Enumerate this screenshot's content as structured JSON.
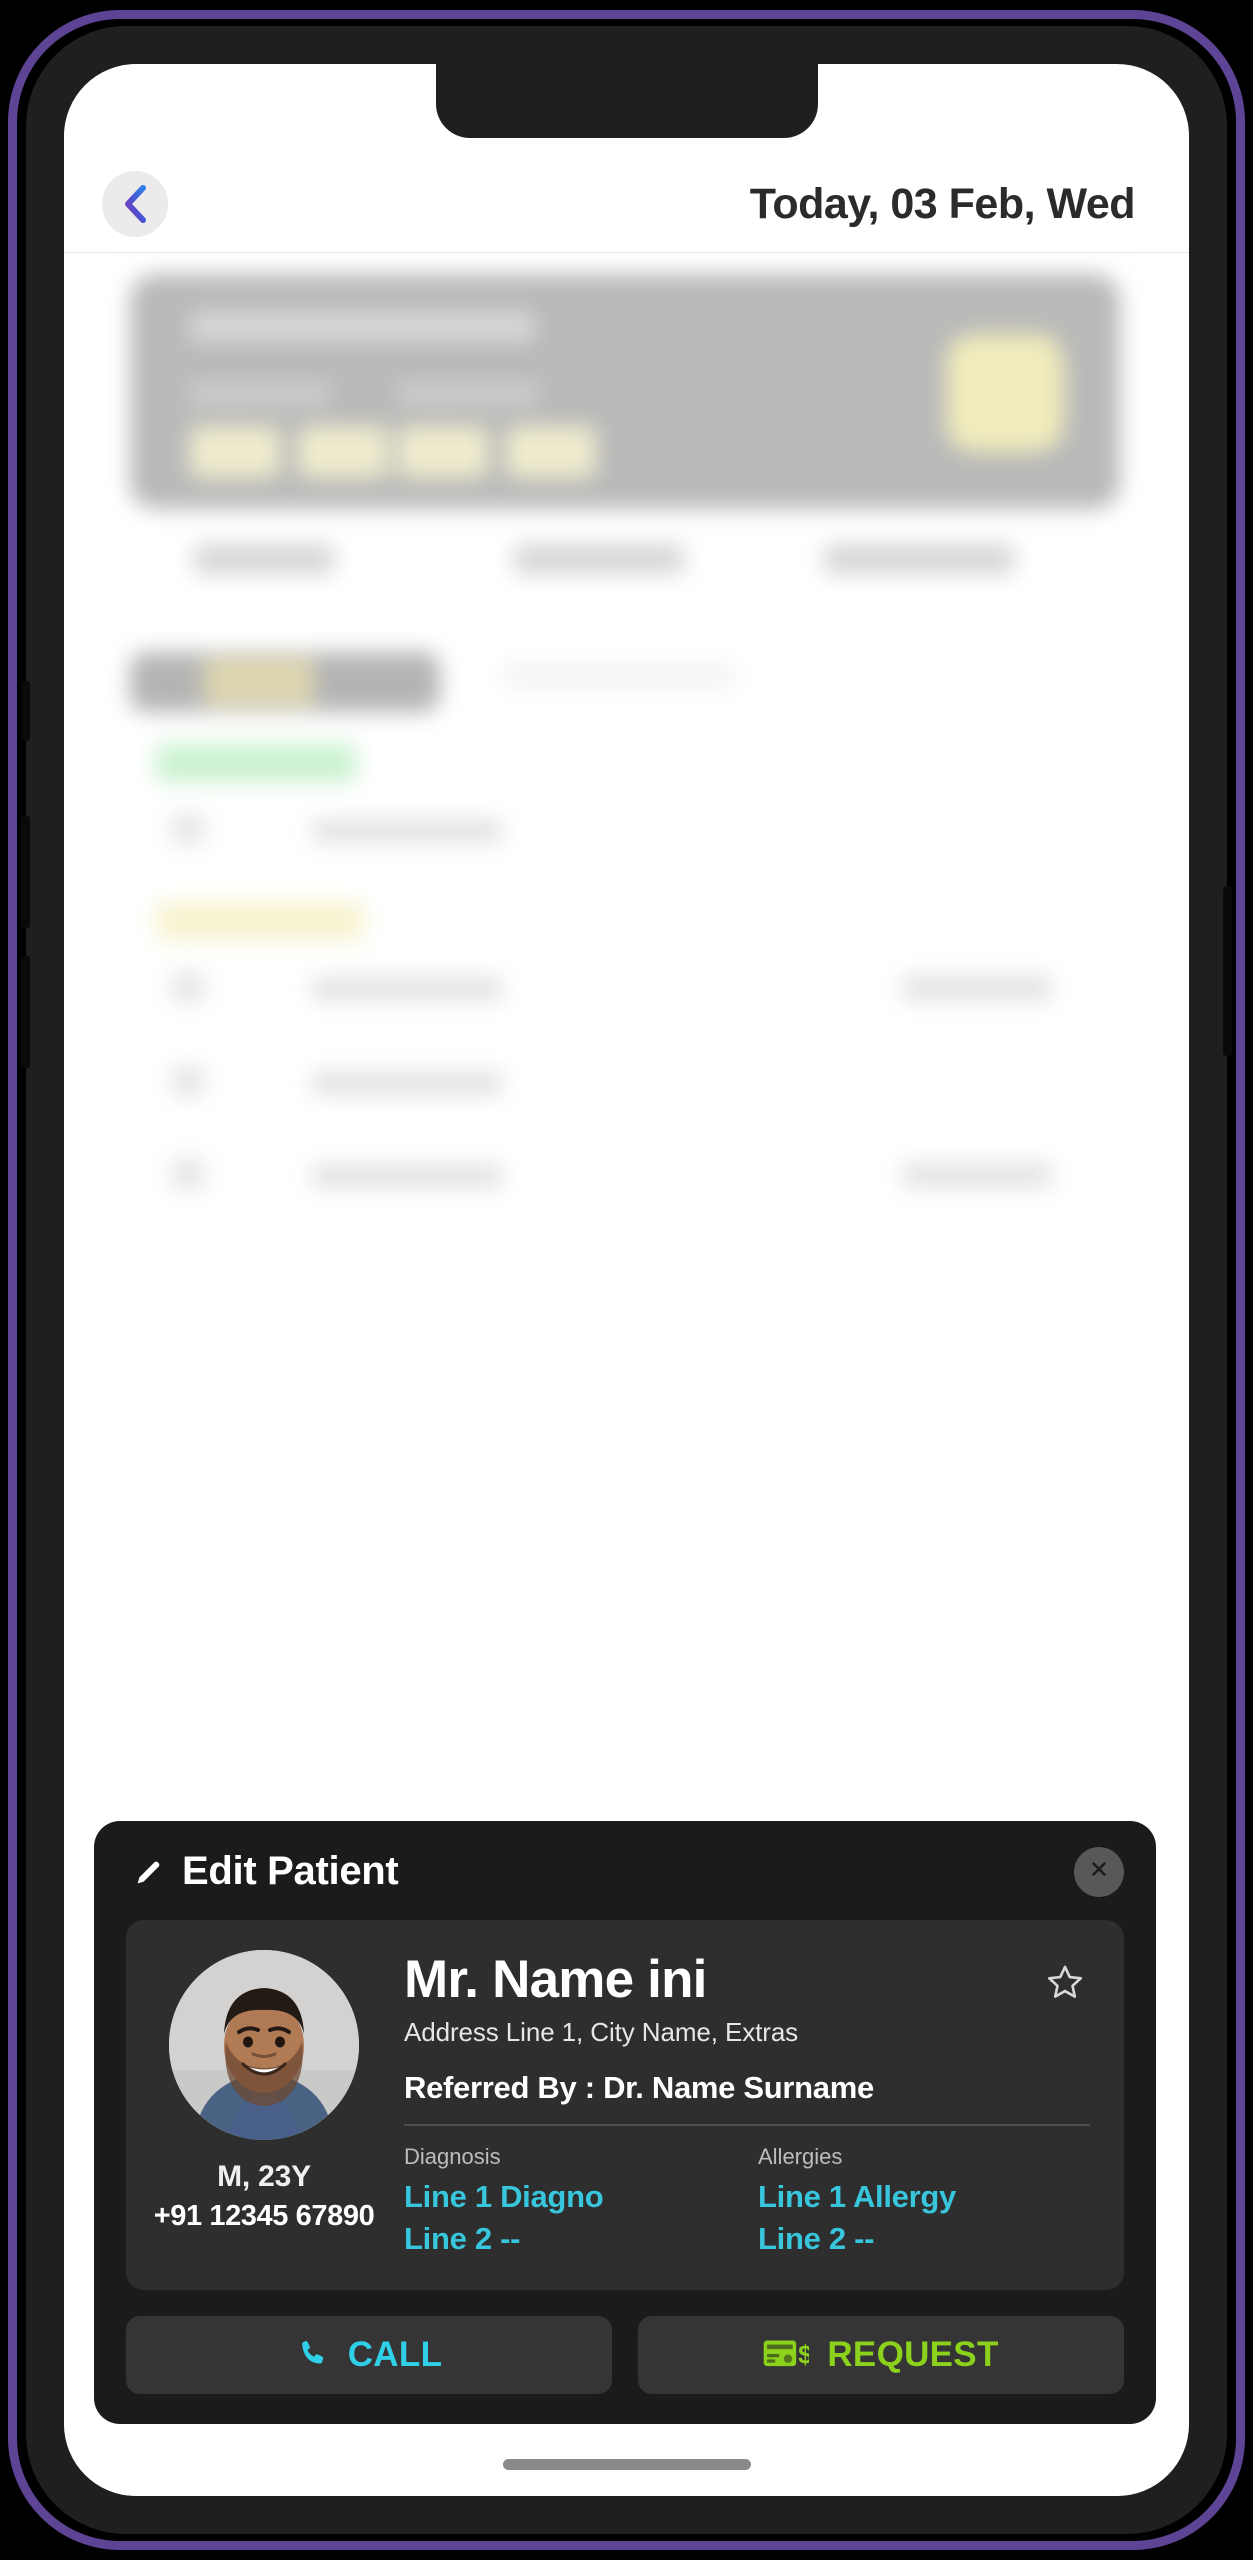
{
  "header": {
    "title": "Today, 03 Feb, Wed",
    "back_icon": "chevron-left-icon"
  },
  "modal": {
    "title": "Edit Patient",
    "edit_icon": "pencil-icon",
    "close_icon": "close-icon",
    "favorite_icon": "star-outline-icon",
    "patient": {
      "name": "Mr. Name ini",
      "address": "Address Line 1, City Name, Extras",
      "referred_by": "Referred By : Dr. Name Surname",
      "gender_age": "M, 23Y",
      "phone": "+91 12345 67890",
      "avatar_icon": "patient-photo-avatar",
      "diagnosis_label": "Diagnosis",
      "diagnosis_line1": "Line 1 Diagno",
      "diagnosis_line2": "Line 2 --",
      "allergies_label": "Allergies",
      "allergies_line1": "Line 1 Allergy",
      "allergies_line2": "Line 2 --"
    },
    "actions": {
      "call_label": "CALL",
      "call_icon": "phone-icon",
      "request_label": "REQUEST",
      "request_icon": "payment-card-dollar-icon"
    }
  },
  "colors": {
    "frame_purple": "#5d4494",
    "phone_bezel": "#1f1f1f",
    "modal_bg": "#1b1b1b",
    "card_bg": "#2e2e2e",
    "accent_cyan": "#38c6dd",
    "accent_green": "#8cd11c",
    "call_cyan": "#2fd0e8"
  }
}
